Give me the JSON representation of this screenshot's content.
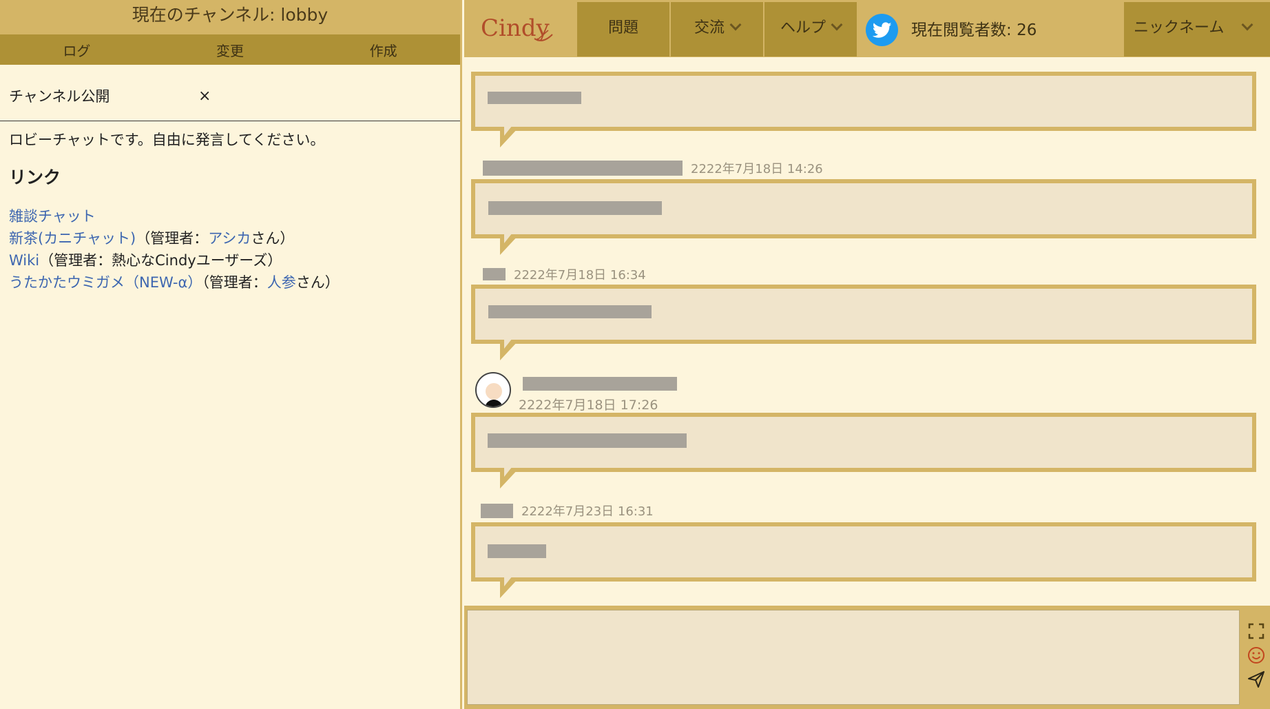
{
  "left": {
    "channel_prefix": "現在のチャンネル:",
    "channel_name": "lobby",
    "tabs": [
      {
        "label": "ログ"
      },
      {
        "label": "変更"
      },
      {
        "label": "作成"
      }
    ],
    "publish_label": "チャンネル公開",
    "publish_close": "×",
    "description": "ロビーチャットです。自由に発言してください。",
    "links_heading": "リンク",
    "links": {
      "l1": {
        "text": "雑談チャット"
      },
      "l2": {
        "text": "新茶(カニチャット)",
        "mid": "（管理者：",
        "admin": "アシカ",
        "end": "さん）"
      },
      "l3": {
        "text": "Wiki",
        "mid": "（管理者：熱心なCindyユーザーズ）"
      },
      "l4": {
        "text": "うたかたウミガメ（NEW-α）",
        "mid": "（管理者：",
        "admin": "人参",
        "end": "さん）"
      }
    }
  },
  "nav": {
    "logo_text": "Cindy",
    "problems": "問題",
    "exchange": "交流",
    "help": "ヘルプ",
    "viewers_label": "現在閲覧者数:",
    "viewers_count": "26",
    "nickname": "ニックネーム"
  },
  "messages": [
    {
      "time": ""
    },
    {
      "time": "2222年7月18日 14:26"
    },
    {
      "time": "2222年7月18日 16:34"
    },
    {
      "time": "2222年7月18日 17:26"
    },
    {
      "time": "2222年7月23日 16:31"
    }
  ],
  "input": {
    "placeholder": ""
  },
  "colors": {
    "header_light": "#d4b566",
    "header_dark": "#ae9136",
    "bubble_fill": "#f0e4cb",
    "link": "#3d66b0",
    "twitter": "#1d9bf0"
  }
}
